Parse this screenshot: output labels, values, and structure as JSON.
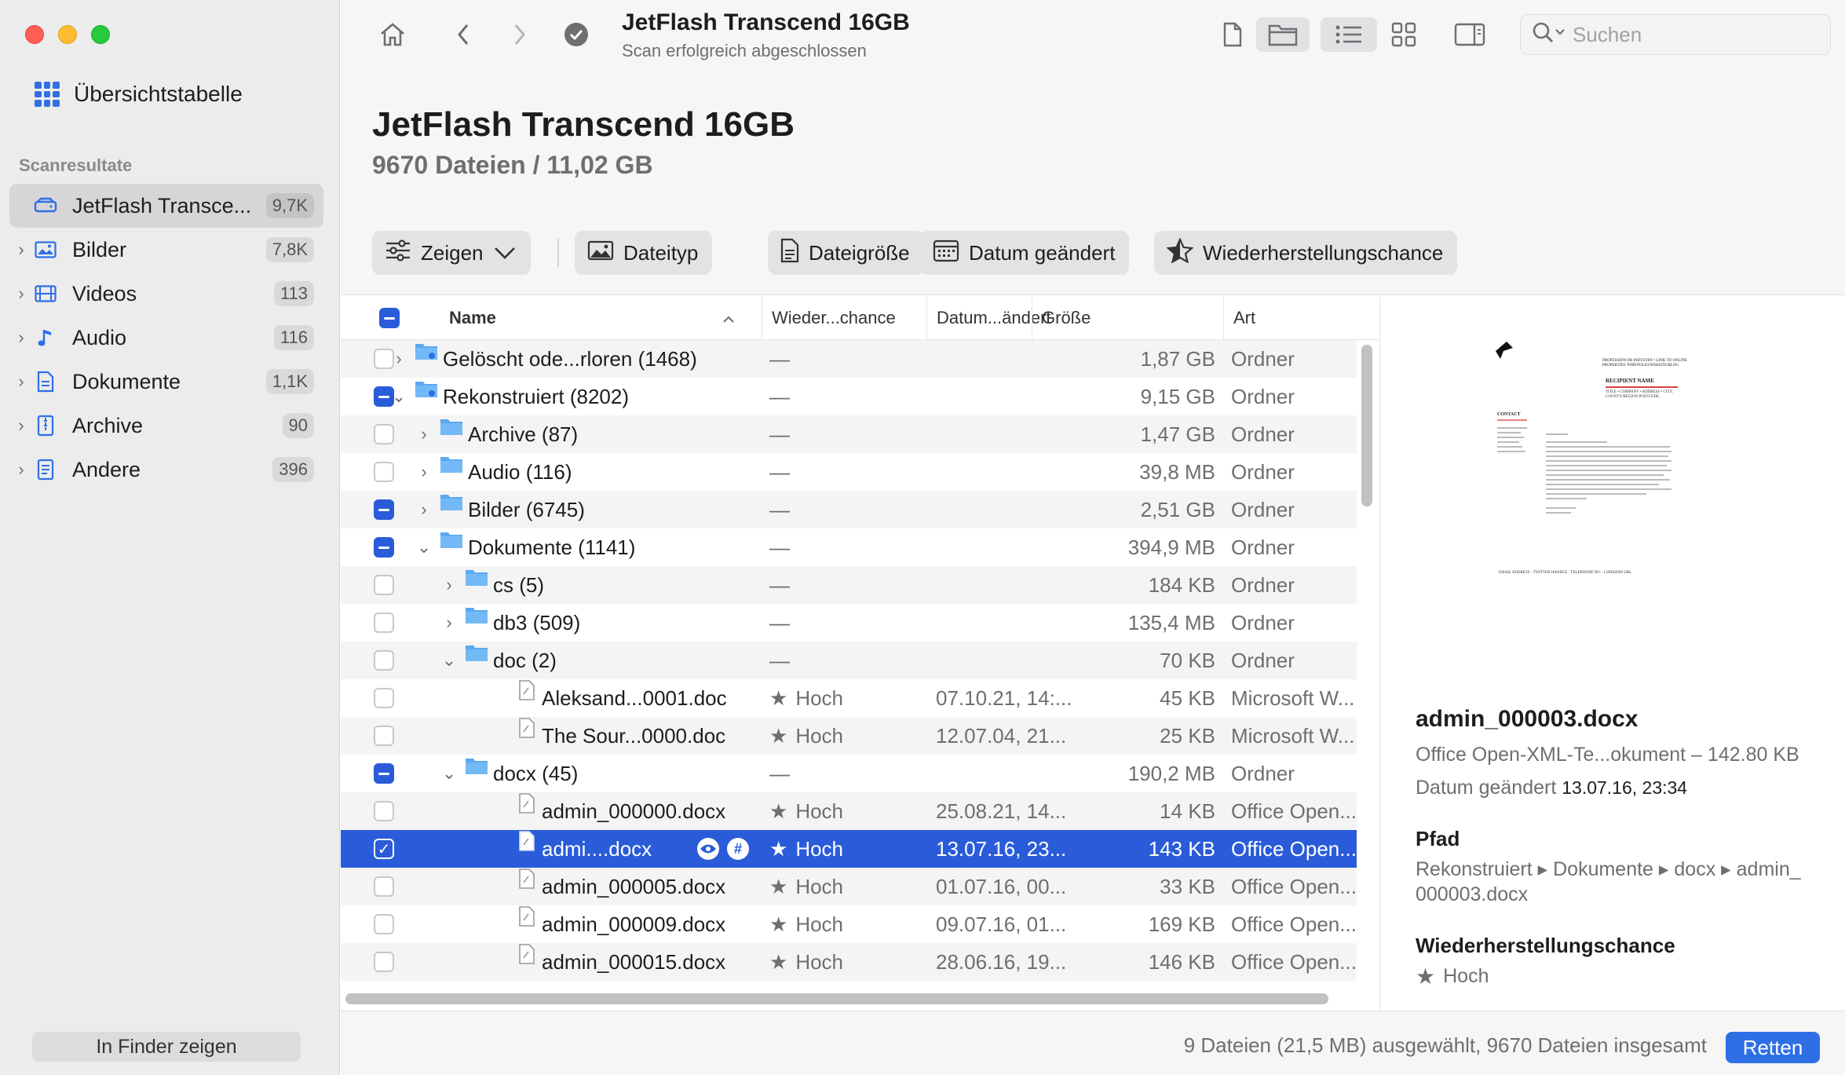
{
  "sidebar": {
    "overview_label": "Übersichtstabelle",
    "section_title": "Scanresultate",
    "items": [
      {
        "label": "JetFlash Transce...",
        "count": "9,7K",
        "icon": "drive-icon"
      },
      {
        "label": "Bilder",
        "count": "7,8K",
        "icon": "image-icon"
      },
      {
        "label": "Videos",
        "count": "113",
        "icon": "film-icon"
      },
      {
        "label": "Audio",
        "count": "116",
        "icon": "music-note-icon"
      },
      {
        "label": "Dokumente",
        "count": "1,1K",
        "icon": "document-icon"
      },
      {
        "label": "Archive",
        "count": "90",
        "icon": "archive-icon"
      },
      {
        "label": "Andere",
        "count": "396",
        "icon": "other-file-icon"
      }
    ],
    "finder_button": "In Finder zeigen"
  },
  "toolbar": {
    "title": "JetFlash Transcend 16GB",
    "subtitle": "Scan erfolgreich abgeschlossen",
    "search_placeholder": "Suchen"
  },
  "header": {
    "title": "JetFlash Transcend 16GB",
    "subtitle": "9670 Dateien / 11,02 GB"
  },
  "filters": {
    "show": "Zeigen",
    "filetype": "Dateityp",
    "filesize": "Dateigröße",
    "date_changed": "Datum geändert",
    "recovery_chance": "Wiederherstellungschance"
  },
  "table": {
    "columns": {
      "name": "Name",
      "chance": "Wieder...chance",
      "date": "Datum...ändert",
      "size": "Größe",
      "kind": "Art"
    },
    "rows": [
      {
        "name": "Gelöscht ode...rloren (1468)",
        "chance": "—",
        "date": "",
        "size": "1,87 GB",
        "kind": "Ordner"
      },
      {
        "name": "Rekonstruiert (8202)",
        "chance": "—",
        "date": "",
        "size": "9,15 GB",
        "kind": "Ordner"
      },
      {
        "name": "Archive (87)",
        "chance": "—",
        "date": "",
        "size": "1,47 GB",
        "kind": "Ordner"
      },
      {
        "name": "Audio (116)",
        "chance": "—",
        "date": "",
        "size": "39,8 MB",
        "kind": "Ordner"
      },
      {
        "name": "Bilder (6745)",
        "chance": "—",
        "date": "",
        "size": "2,51 GB",
        "kind": "Ordner"
      },
      {
        "name": "Dokumente (1141)",
        "chance": "—",
        "date": "",
        "size": "394,9 MB",
        "kind": "Ordner"
      },
      {
        "name": "cs (5)",
        "chance": "—",
        "date": "",
        "size": "184 KB",
        "kind": "Ordner"
      },
      {
        "name": "db3 (509)",
        "chance": "—",
        "date": "",
        "size": "135,4 MB",
        "kind": "Ordner"
      },
      {
        "name": "doc (2)",
        "chance": "—",
        "date": "",
        "size": "70 KB",
        "kind": "Ordner"
      },
      {
        "name": "Aleksand...0001.doc",
        "chance": "Hoch",
        "date": "07.10.21, 14:...",
        "size": "45 KB",
        "kind": "Microsoft W..."
      },
      {
        "name": "The Sour...0000.doc",
        "chance": "Hoch",
        "date": "12.07.04, 21...",
        "size": "25 KB",
        "kind": "Microsoft W..."
      },
      {
        "name": "docx (45)",
        "chance": "—",
        "date": "",
        "size": "190,2 MB",
        "kind": "Ordner"
      },
      {
        "name": "admin_000000.docx",
        "chance": "Hoch",
        "date": "25.08.21, 14...",
        "size": "14 KB",
        "kind": "Office Open..."
      },
      {
        "name": "admi....docx",
        "chance": "Hoch",
        "date": "13.07.16, 23...",
        "size": "143 KB",
        "kind": "Office Open..."
      },
      {
        "name": "admin_000005.docx",
        "chance": "Hoch",
        "date": "01.07.16, 00...",
        "size": "33 KB",
        "kind": "Office Open..."
      },
      {
        "name": "admin_000009.docx",
        "chance": "Hoch",
        "date": "09.07.16, 01...",
        "size": "169 KB",
        "kind": "Office Open..."
      },
      {
        "name": "admin_000015.docx",
        "chance": "Hoch",
        "date": "28.06.16, 19...",
        "size": "146 KB",
        "kind": "Office Open..."
      }
    ]
  },
  "preview": {
    "doc_text": {
      "heading": "PROFESSION OR INDUSTRY • LINK TO ONLINE PROPERTIES: PORTFOLIO/WEBSITE/BLOG",
      "recipient": "RECIPIENT NAME",
      "address_line": "TITLE • COMPANY • ADDRESS • CITY, COUNTY/REGION POSTCODE",
      "contact": "CONTACT",
      "footer": "EMAIL ADDRESS · TWITTER HANDLE · TELEPHONE NO. · LINKEDIN URL"
    },
    "file_name": "admin_000003.docx",
    "meta": "Office Open-XML-Te...okument – 142.80 KB",
    "date_label": "Datum geändert",
    "date_value": "13.07.16, 23:34",
    "path_heading": "Pfad",
    "path": "Rekonstruiert ▸ Dokumente ▸ docx ▸ admin_ 000003.docx",
    "chance_heading": "Wiederherstellungschance",
    "chance_value": "Hoch"
  },
  "footer": {
    "status": "9 Dateien (21,5 MB) ausgewählt, 9670 Dateien insgesamt",
    "recover_button": "Retten"
  },
  "colors": {
    "accent": "#2a5cd9",
    "folder": "#5aa9f0",
    "close": "#ff5f57",
    "minimize": "#febc2e",
    "zoom": "#28c840"
  }
}
